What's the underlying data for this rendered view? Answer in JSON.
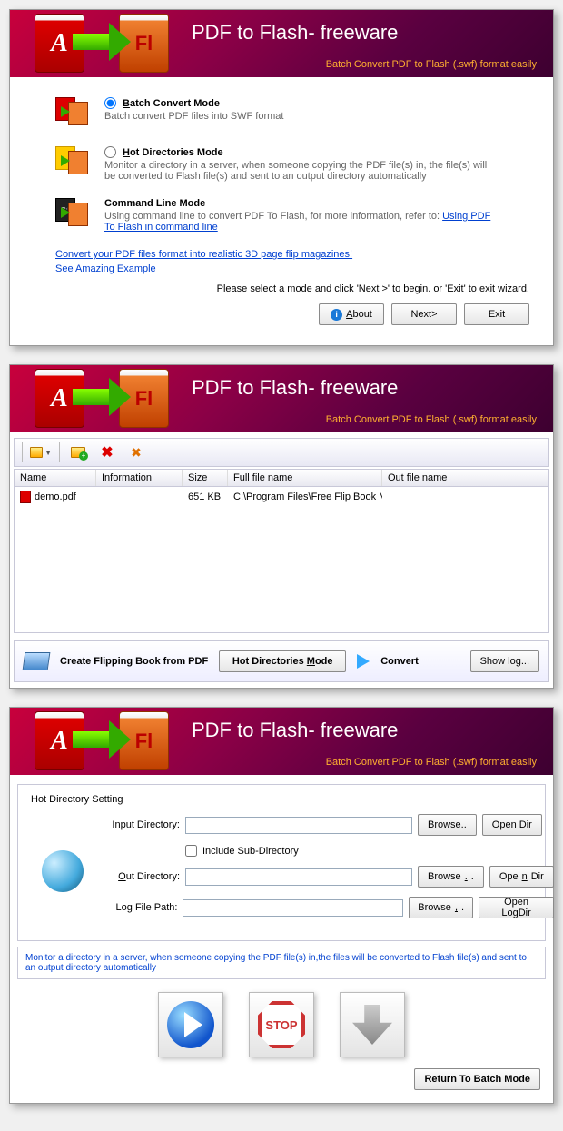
{
  "header": {
    "title": "PDF to Flash- freeware",
    "subtitle": "Batch Convert PDF to Flash (.swf) format easily"
  },
  "win1": {
    "modes": {
      "batch": {
        "title": "Batch Convert Mode",
        "desc": "Batch convert PDF files into SWF format"
      },
      "hot": {
        "title": "Hot Directories Mode",
        "desc": "Monitor a directory in a server, when someone copying the PDF file(s) in, the file(s) will be converted to Flash file(s) and sent to an output directory automatically"
      },
      "cmd": {
        "title": "Command Line Mode",
        "desc_pre": "Using command line to convert PDF To Flash, for more information, refer to:  ",
        "link": "Using PDF To Flash in command line"
      }
    },
    "links": {
      "l1": "Convert your PDF files format into realistic 3D page flip magazines!",
      "l2": "See Amazing Example "
    },
    "hint": "Please select a mode and click 'Next >' to begin. or 'Exit' to exit wizard.",
    "buttons": {
      "about": "About",
      "next": "Next>",
      "exit": "Exit"
    }
  },
  "win2": {
    "cols": {
      "name": "Name",
      "info": "Information",
      "size": "Size",
      "full": "Full file name",
      "out": "Out file name"
    },
    "row": {
      "name": "demo.pdf",
      "info": "",
      "size": "651 KB",
      "full": "C:\\Program Files\\Free Flip Book Maker for ...",
      "out": ""
    },
    "footer": {
      "flip": "Create Flipping Book  from PDF",
      "hot": "Hot Directories Mode",
      "convert": "Convert",
      "showlog": "Show log..."
    }
  },
  "win3": {
    "fs_title": "Hot Directory Setting",
    "labels": {
      "input": "Input Directory:",
      "sub": "Include Sub-Directory",
      "out": "Out Directory:",
      "log": "Log File Path:"
    },
    "buttons": {
      "browse": "Browse..",
      "opendir": "Open Dir",
      "openlogdir": "Open LogDir",
      "return": "Return To Batch Mode",
      "stop": "STOP"
    },
    "note": "Monitor a directory in a server, when someone copying the PDF file(s) in,the files will be converted to Flash file(s) and sent to an output directory automatically"
  }
}
